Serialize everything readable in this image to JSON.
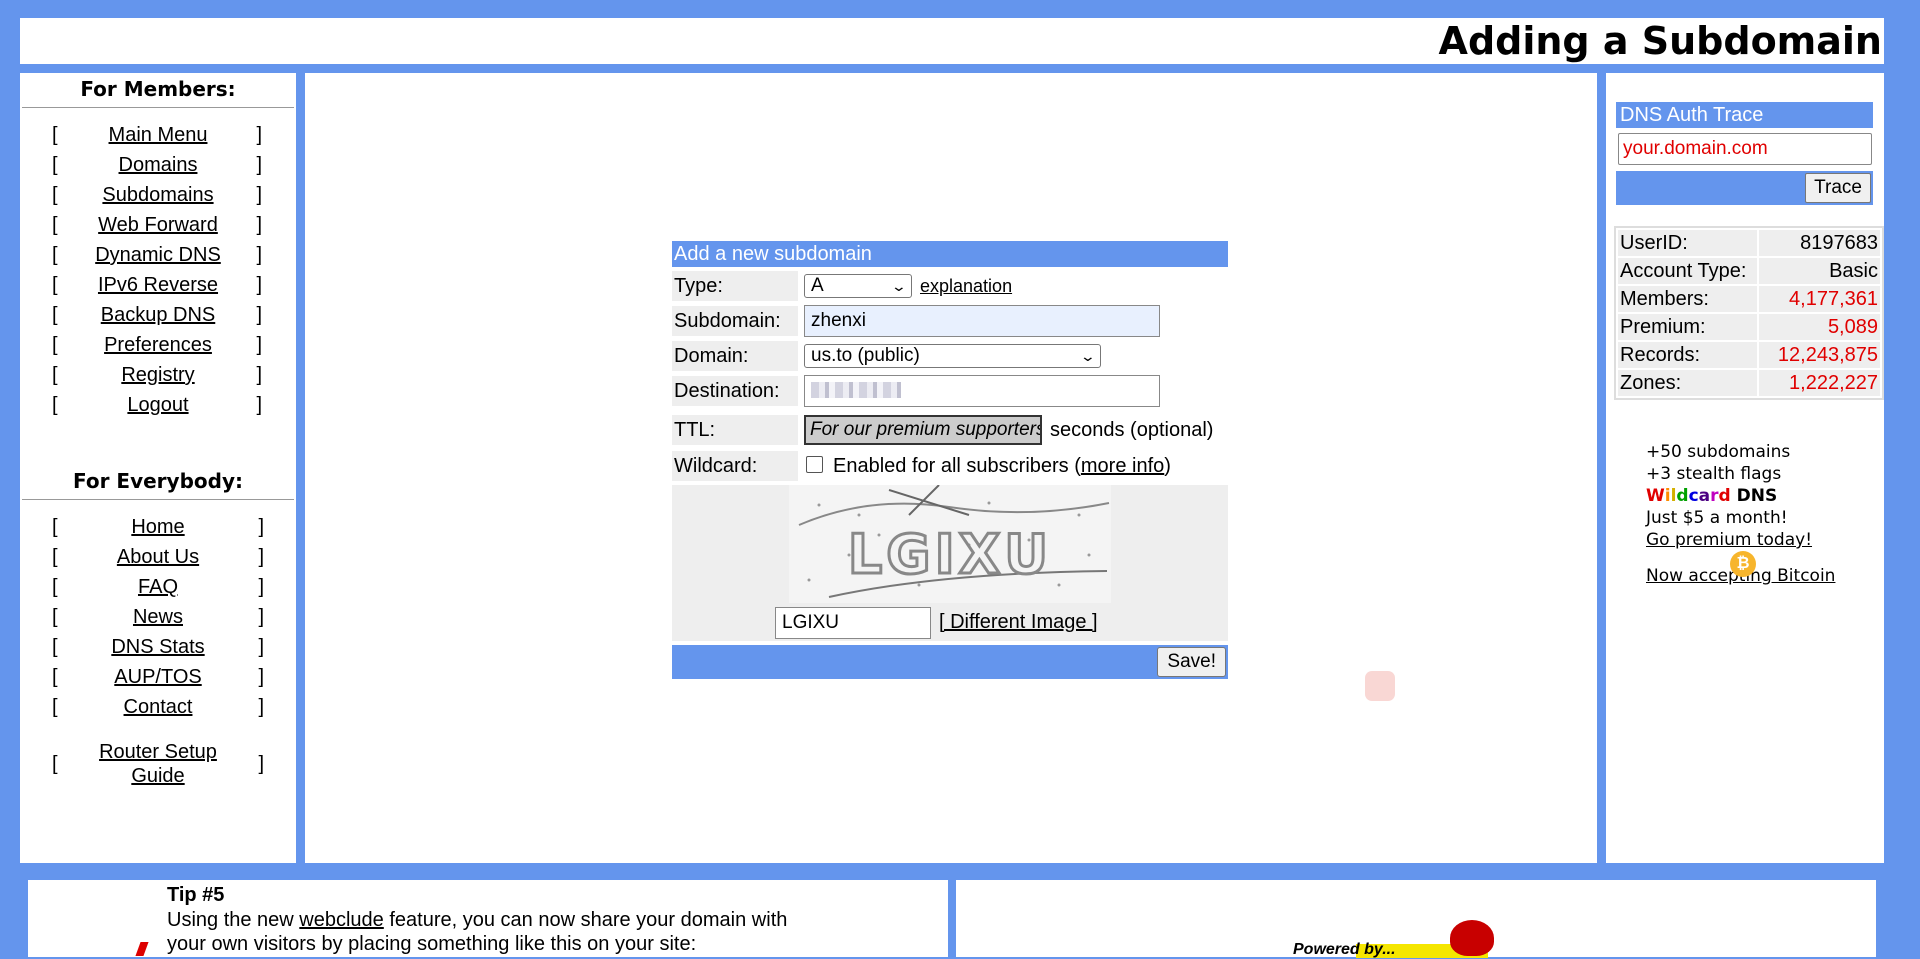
{
  "header": {
    "title": "Adding a Subdomain"
  },
  "members": {
    "heading": "For Members:",
    "items": [
      {
        "label": "Main Menu"
      },
      {
        "label": "Domains"
      },
      {
        "label": "Subdomains"
      },
      {
        "label": "Web Forward"
      },
      {
        "label": "Dynamic DNS"
      },
      {
        "label": "IPv6 Reverse"
      },
      {
        "label": "Backup DNS"
      },
      {
        "label": "Preferences"
      },
      {
        "label": "Registry"
      },
      {
        "label": "Logout"
      }
    ]
  },
  "everybody": {
    "heading": "For Everybody:",
    "items": [
      {
        "label": "Home"
      },
      {
        "label": "About Us"
      },
      {
        "label": "FAQ"
      },
      {
        "label": "News"
      },
      {
        "label": "DNS Stats"
      },
      {
        "label": "AUP/TOS"
      },
      {
        "label": "Contact"
      }
    ],
    "router": "Router Setup Guide"
  },
  "form": {
    "title": "Add a new subdomain",
    "type_label": "Type:",
    "type_value": "A",
    "explanation_link": "explanation",
    "subdomain_label": "Subdomain:",
    "subdomain_value": "zhenxi",
    "domain_label": "Domain:",
    "domain_value": "us.to (public)",
    "destination_label": "Destination:",
    "ttl_label": "TTL:",
    "ttl_placeholder": "For our premium supporters",
    "ttl_suffix": "seconds (optional)",
    "wildcard_label": "Wildcard:",
    "wildcard_text": "Enabled for all subscribers (",
    "wildcard_link": "more info",
    "wildcard_close": ")",
    "captcha_text": "LGIXU",
    "captcha_value": "LGIXU",
    "different_image": "[ Different Image ]",
    "save": "Save!"
  },
  "trace": {
    "heading": "DNS Auth Trace",
    "placeholder": "your.domain.com",
    "button": "Trace"
  },
  "stats": [
    {
      "key": "UserID:",
      "value": "8197683",
      "color": "#000000"
    },
    {
      "key": "Account Type:",
      "value": "Basic",
      "color": "#000000"
    },
    {
      "key": "Members:",
      "value": "4,177,361",
      "color": "#e00000"
    },
    {
      "key": "Premium:",
      "value": "5,089",
      "color": "#e00000"
    },
    {
      "key": "Records:",
      "value": "12,243,875",
      "color": "#e00000"
    },
    {
      "key": "Zones:",
      "value": "1,222,227",
      "color": "#e00000"
    }
  ],
  "promo": {
    "line1": "+50 subdomains",
    "line2": "+3 stealth flags",
    "wild_letters": [
      "W",
      "i",
      "l",
      "d",
      "c",
      "a",
      "r",
      "d"
    ],
    "wild_colors": [
      "#e00000",
      "#ff8c00",
      "#d4b000",
      "#00a000",
      "#0000e0",
      "#4b0082",
      "#c000c0",
      "#e00000"
    ],
    "dns": " DNS",
    "line4": "Just $5 a month!",
    "cta": "Go premium today!",
    "bitcoin": "Now accepting Bitcoin"
  },
  "tip": {
    "title": "Tip #5",
    "text_before": "Using the new ",
    "link": "webclude",
    "text_after": " feature, you can now share your domain with",
    "line2": "your own visitors by placing something like this on your site:"
  },
  "powered": {
    "text": "Powered by..."
  },
  "colors": {
    "accent": "#6495ED",
    "stat_red": "#e00000"
  }
}
